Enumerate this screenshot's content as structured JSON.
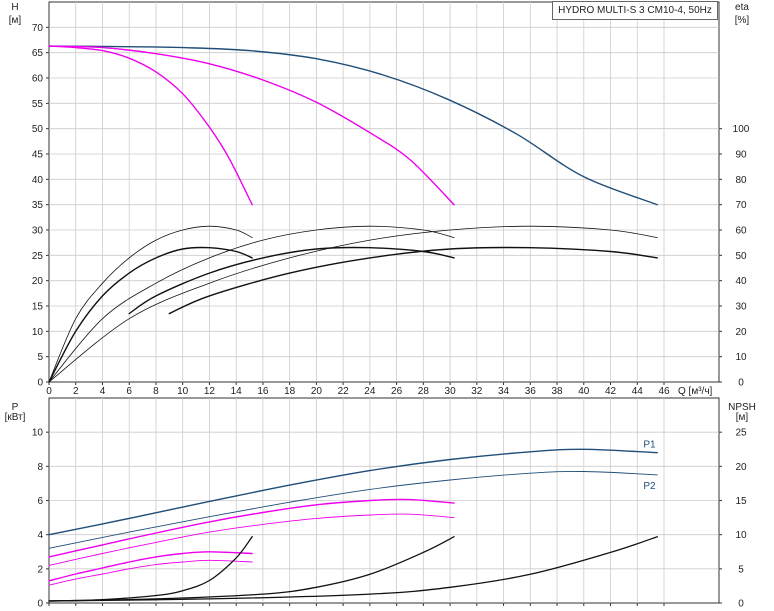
{
  "title": "HYDRO MULTI-S 3 CM10-4, 50Hz",
  "colors": {
    "navy": "#1f4e79",
    "magenta": "#ee00ee",
    "black": "#111111",
    "grid": "#cccccc",
    "axis": "#333333"
  },
  "chart_data": [
    {
      "type": "line",
      "id": "head_efficiency",
      "title": "HYDRO MULTI-S 3 CM10-4, 50Hz",
      "xlabel": "Q [м³/ч]",
      "ylabel": "H [м]",
      "y2label": "eta [%]",
      "y_left_label": "H",
      "y_left_unit": "[м]",
      "y_right_label": "eta",
      "y_right_unit": "[%]",
      "xlim": [
        0,
        50
      ],
      "ylim": [
        0,
        75
      ],
      "y2lim": [
        0,
        150
      ],
      "xticks": [
        0,
        2,
        4,
        6,
        8,
        10,
        12,
        14,
        16,
        18,
        20,
        22,
        24,
        26,
        28,
        30,
        32,
        34,
        36,
        38,
        40,
        42,
        44,
        46
      ],
      "yticks": [
        0,
        5,
        10,
        15,
        20,
        25,
        30,
        35,
        40,
        45,
        50,
        55,
        60,
        65,
        70
      ],
      "y2ticks": [
        0,
        10,
        20,
        30,
        40,
        50,
        60,
        70,
        80,
        90,
        100
      ],
      "grid": true,
      "series": [
        {
          "axis": "left",
          "color": "navy",
          "width": 1.4,
          "points": [
            [
              0,
              66.3
            ],
            [
              5,
              66.2
            ],
            [
              10,
              66.0
            ],
            [
              15,
              65.4
            ],
            [
              20,
              63.8
            ],
            [
              25,
              60.6
            ],
            [
              30,
              55.6
            ],
            [
              35,
              48.9
            ],
            [
              40,
              40.5
            ],
            [
              45.5,
              35.0
            ]
          ]
        },
        {
          "axis": "left",
          "color": "magenta",
          "width": 1.4,
          "points": [
            [
              0,
              66.3
            ],
            [
              4,
              66.0
            ],
            [
              8,
              64.8
            ],
            [
              12,
              62.8
            ],
            [
              16,
              59.6
            ],
            [
              20,
              55.2
            ],
            [
              24,
              49.2
            ],
            [
              27,
              43.9
            ],
            [
              30.3,
              35.0
            ]
          ]
        },
        {
          "axis": "left",
          "color": "magenta",
          "width": 1.4,
          "points": [
            [
              0,
              66.3
            ],
            [
              2,
              66.0
            ],
            [
              4,
              65.4
            ],
            [
              6,
              63.9
            ],
            [
              8,
              61.2
            ],
            [
              10,
              56.9
            ],
            [
              12,
              50.3
            ],
            [
              13.5,
              44.0
            ],
            [
              15.2,
              35.0
            ]
          ]
        },
        {
          "axis": "right",
          "color": "black",
          "width": 0.8,
          "points": [
            [
              0,
              0
            ],
            [
              2,
              25
            ],
            [
              4,
              39
            ],
            [
              6,
              49
            ],
            [
              8,
              56
            ],
            [
              10,
              60
            ],
            [
              12,
              61.5
            ],
            [
              14,
              60
            ],
            [
              15.2,
              57
            ]
          ]
        },
        {
          "axis": "right",
          "color": "black",
          "width": 1.4,
          "points": [
            [
              0,
              0
            ],
            [
              2,
              20
            ],
            [
              4,
              34
            ],
            [
              6,
              43
            ],
            [
              8,
              49
            ],
            [
              10,
              52.5
            ],
            [
              12,
              53
            ],
            [
              14,
              51.5
            ],
            [
              15.2,
              49
            ]
          ]
        },
        {
          "axis": "right",
          "color": "black",
          "width": 0.8,
          "points": [
            [
              0,
              0
            ],
            [
              4,
              25
            ],
            [
              8,
              39
            ],
            [
              12,
              49
            ],
            [
              16,
              56
            ],
            [
              20,
              60
            ],
            [
              24,
              61.5
            ],
            [
              28,
              60
            ],
            [
              30.3,
              57
            ]
          ]
        },
        {
          "axis": "right",
          "color": "black",
          "width": 1.4,
          "points": [
            [
              6,
              27
            ],
            [
              8,
              34
            ],
            [
              12,
              43
            ],
            [
              16,
              49
            ],
            [
              20,
              52.5
            ],
            [
              24,
              53
            ],
            [
              28,
              51.5
            ],
            [
              30.3,
              49
            ]
          ]
        },
        {
          "axis": "right",
          "color": "black",
          "width": 0.8,
          "points": [
            [
              0,
              0
            ],
            [
              6,
              25
            ],
            [
              12,
              39
            ],
            [
              18,
              49
            ],
            [
              24,
              56
            ],
            [
              30,
              60
            ],
            [
              36,
              61.5
            ],
            [
              42,
              60
            ],
            [
              45.5,
              57
            ]
          ]
        },
        {
          "axis": "right",
          "color": "black",
          "width": 1.4,
          "points": [
            [
              9,
              27
            ],
            [
              12,
              34
            ],
            [
              18,
              43
            ],
            [
              24,
              49
            ],
            [
              30,
              52.5
            ],
            [
              36,
              53
            ],
            [
              42,
              51.5
            ],
            [
              45.5,
              49
            ]
          ]
        }
      ]
    },
    {
      "type": "line",
      "id": "power_npsh",
      "xlabel": "Q [м³/ч]",
      "ylabel": "P [кВт]",
      "y2label": "NPSH [м]",
      "y_left_label": "P",
      "y_left_unit": "[кВт]",
      "y_right_label": "NPSH",
      "y_right_unit": "[м]",
      "xlim": [
        0,
        50
      ],
      "ylim": [
        0,
        12
      ],
      "y2lim": [
        0,
        30
      ],
      "xticks": [
        0,
        2,
        4,
        6,
        8,
        10,
        12,
        14,
        16,
        18,
        20,
        22,
        24,
        26,
        28,
        30,
        32,
        34,
        36,
        38,
        40,
        42,
        44,
        46
      ],
      "yticks": [
        0,
        2,
        4,
        6,
        8,
        10
      ],
      "y2ticks": [
        0,
        5,
        10,
        15,
        20,
        25
      ],
      "grid": true,
      "series": [
        {
          "name": "P1",
          "axis": "left",
          "color": "navy",
          "width": 1.4,
          "points": [
            [
              0,
              4.0
            ],
            [
              6,
              4.95
            ],
            [
              12,
              5.95
            ],
            [
              18,
              6.9
            ],
            [
              24,
              7.75
            ],
            [
              30,
              8.4
            ],
            [
              36,
              8.85
            ],
            [
              40,
              9.0
            ],
            [
              45.5,
              8.8
            ]
          ]
        },
        {
          "name": "P2",
          "axis": "left",
          "color": "navy",
          "width": 0.9,
          "points": [
            [
              0,
              3.2
            ],
            [
              6,
              4.15
            ],
            [
              12,
              5.05
            ],
            [
              18,
              5.9
            ],
            [
              24,
              6.65
            ],
            [
              30,
              7.2
            ],
            [
              36,
              7.6
            ],
            [
              40,
              7.7
            ],
            [
              45.5,
              7.5
            ]
          ]
        },
        {
          "axis": "left",
          "color": "magenta",
          "width": 1.4,
          "points": [
            [
              0,
              2.7
            ],
            [
              4,
              3.4
            ],
            [
              8,
              4.1
            ],
            [
              12,
              4.75
            ],
            [
              16,
              5.3
            ],
            [
              20,
              5.75
            ],
            [
              24,
              6.0
            ],
            [
              27,
              6.05
            ],
            [
              30.3,
              5.85
            ]
          ]
        },
        {
          "axis": "left",
          "color": "magenta",
          "width": 0.9,
          "points": [
            [
              0,
              2.2
            ],
            [
              4,
              2.9
            ],
            [
              8,
              3.55
            ],
            [
              12,
              4.15
            ],
            [
              16,
              4.6
            ],
            [
              20,
              4.95
            ],
            [
              24,
              5.15
            ],
            [
              27,
              5.2
            ],
            [
              30.3,
              5.0
            ]
          ]
        },
        {
          "axis": "left",
          "color": "magenta",
          "width": 1.4,
          "points": [
            [
              0,
              1.3
            ],
            [
              2,
              1.7
            ],
            [
              4,
              2.05
            ],
            [
              6,
              2.4
            ],
            [
              8,
              2.7
            ],
            [
              10,
              2.9
            ],
            [
              12,
              3.0
            ],
            [
              15.2,
              2.9
            ]
          ]
        },
        {
          "axis": "left",
          "color": "magenta",
          "width": 0.9,
          "points": [
            [
              0,
              1.05
            ],
            [
              2,
              1.4
            ],
            [
              4,
              1.7
            ],
            [
              6,
              2.0
            ],
            [
              8,
              2.25
            ],
            [
              10,
              2.4
            ],
            [
              12,
              2.5
            ],
            [
              15.2,
              2.4
            ]
          ]
        },
        {
          "axis": "right",
          "color": "black",
          "width": 1.3,
          "points": [
            [
              0,
              0.3
            ],
            [
              4,
              0.5
            ],
            [
              8,
              1.1
            ],
            [
              10,
              1.8
            ],
            [
              12,
              3.3
            ],
            [
              14,
              6.6
            ],
            [
              15.2,
              9.7
            ]
          ]
        },
        {
          "axis": "right",
          "color": "black",
          "width": 1.3,
          "points": [
            [
              0,
              0.3
            ],
            [
              8,
              0.6
            ],
            [
              16,
              1.3
            ],
            [
              20,
              2.3
            ],
            [
              24,
              4.2
            ],
            [
              28,
              7.4
            ],
            [
              30.3,
              9.7
            ]
          ]
        },
        {
          "axis": "right",
          "color": "black",
          "width": 1.3,
          "points": [
            [
              0,
              0.3
            ],
            [
              12,
              0.6
            ],
            [
              24,
              1.3
            ],
            [
              30,
              2.3
            ],
            [
              36,
              4.2
            ],
            [
              42,
              7.4
            ],
            [
              45.5,
              9.7
            ]
          ]
        }
      ]
    }
  ]
}
